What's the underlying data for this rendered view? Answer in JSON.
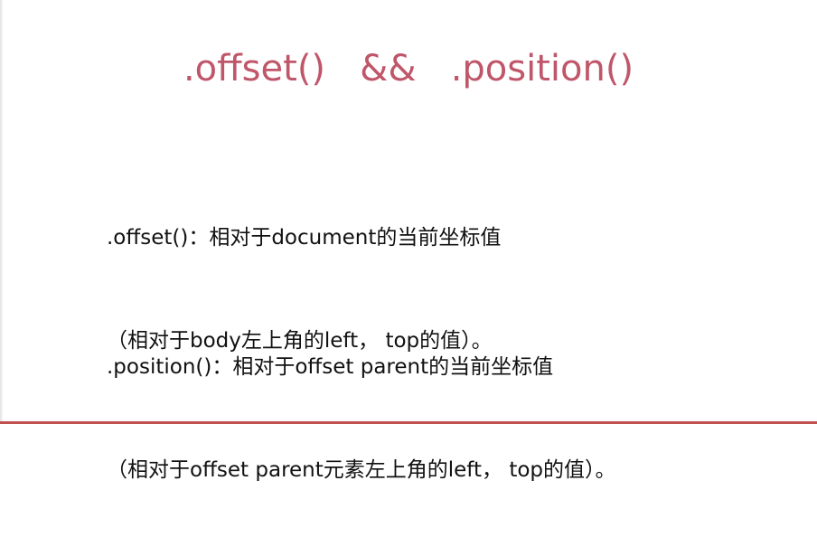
{
  "slide": {
    "title": ".offset()   &&   .position()",
    "offset_section": {
      "line1": ".offset()：相对于document的当前坐标值",
      "line2": "（相对于body左上角的left， top的值）。"
    },
    "position_section": {
      "line1": ".position()：相对于offset parent的当前坐标值",
      "line2": "（相对于offset parent元素左上角的left， top的值）。"
    }
  },
  "colors": {
    "title": "#c0566a",
    "body_text": "#111111",
    "bottom_bar": "#c0504d"
  }
}
